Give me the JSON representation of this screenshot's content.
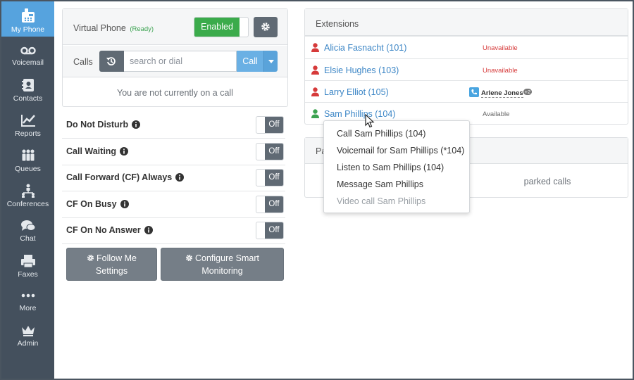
{
  "sidebar": {
    "items": [
      {
        "label": "My Phone",
        "icon": "phone-icon",
        "active": true
      },
      {
        "label": "Voicemail",
        "icon": "voicemail-icon"
      },
      {
        "label": "Contacts",
        "icon": "contacts-icon"
      },
      {
        "label": "Reports",
        "icon": "reports-icon"
      },
      {
        "label": "Queues",
        "icon": "queues-icon"
      },
      {
        "label": "Conferences",
        "icon": "conferences-icon"
      },
      {
        "label": "Chat",
        "icon": "chat-icon"
      },
      {
        "label": "Faxes",
        "icon": "fax-icon"
      },
      {
        "label": "More",
        "icon": "more-icon"
      },
      {
        "label": "Admin",
        "icon": "crown-icon"
      }
    ]
  },
  "virtual_phone": {
    "title": "Virtual Phone",
    "status": "(Ready)",
    "toggle_label": "Enabled"
  },
  "calls": {
    "label": "Calls",
    "search_placeholder": "search or dial",
    "call_button": "Call",
    "empty_message": "You are not currently on a call"
  },
  "settings": [
    {
      "label": "Do Not Disturb",
      "state": "Off"
    },
    {
      "label": "Call Waiting",
      "state": "Off"
    },
    {
      "label": "Call Forward (CF) Always",
      "state": "Off"
    },
    {
      "label": "CF On Busy",
      "state": "Off"
    },
    {
      "label": "CF On No Answer",
      "state": "Off"
    }
  ],
  "buttons": {
    "follow_me": [
      "Follow Me",
      "Settings"
    ],
    "smart_monitoring": [
      "Configure Smart",
      "Monitoring"
    ]
  },
  "extensions": {
    "title": "Extensions",
    "rows": [
      {
        "name": "Alicia Fasnacht (101)",
        "status": "Unavailable",
        "color": "#d63a3a"
      },
      {
        "name": "Elsie Hughes (103)",
        "status": "Unavailable",
        "color": "#d63a3a"
      },
      {
        "name": "Larry Elliot (105)",
        "busy_with": "Arlene Jones",
        "badge": "+2",
        "color": "#d63a3a"
      },
      {
        "name": "Sam Phillips (104)",
        "status": "Available",
        "color": "#3ca351"
      }
    ]
  },
  "parked": {
    "title_visible": "Pa",
    "message_visible": "parked calls"
  },
  "context_menu": {
    "items": [
      {
        "label": "Call Sam Phillips (104)",
        "enabled": true
      },
      {
        "label": "Voicemail for Sam Phillips (*104)",
        "enabled": true
      },
      {
        "label": "Listen to Sam Phillips (104)",
        "enabled": true
      },
      {
        "label": "Message Sam Phillips",
        "enabled": true
      },
      {
        "label": "Video call Sam Phillips",
        "enabled": false
      }
    ]
  },
  "colors": {
    "sidebar_bg": "#44505d",
    "active_nav": "#56a3de",
    "enabled_green": "#3bab4b",
    "link_blue": "#3c86c6",
    "unavailable_red": "#d63a3a"
  }
}
